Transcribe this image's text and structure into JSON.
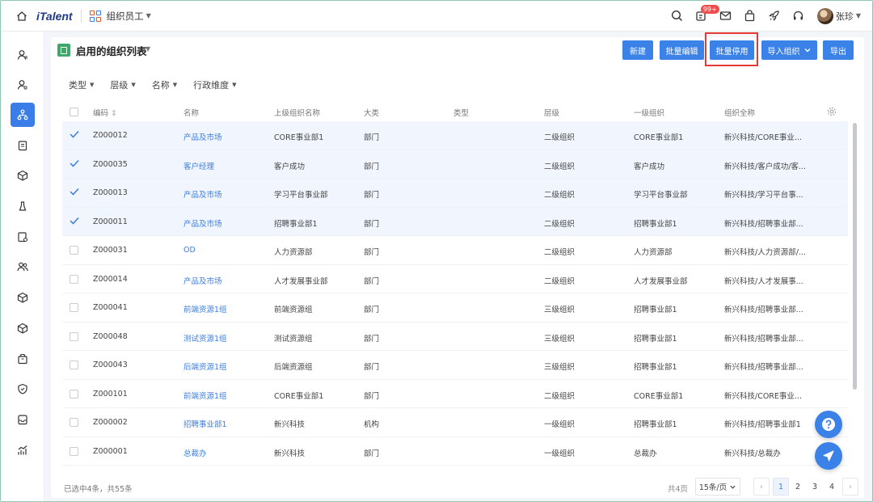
{
  "topbar": {
    "logo": "iTalent",
    "app_name": "组织员工",
    "badge_count": "99+",
    "user_name": "张珍",
    "icons": [
      "home-icon",
      "apps-icon",
      "search-icon",
      "message-icon",
      "mail-icon",
      "bag-icon",
      "rocket-icon",
      "headset-icon"
    ]
  },
  "sidebar": {
    "items": [
      "person-icon",
      "person-search-icon",
      "org-icon",
      "doc-icon",
      "cube-icon",
      "flask-icon",
      "doc-settings-icon",
      "people-icon",
      "cube-icon",
      "cube-icon",
      "box-icon",
      "shield-icon",
      "inbox-icon",
      "chart-icon"
    ],
    "active_index": 2
  },
  "card": {
    "title": "启用的组织列表"
  },
  "toolbar": {
    "new": "新建",
    "batch_edit": "批量编辑",
    "batch_disable": "批量停用",
    "import_org": "导入组织",
    "export": "导出"
  },
  "filters": [
    "类型",
    "层级",
    "名称",
    "行政维度"
  ],
  "table": {
    "headers": [
      "编码",
      "名称",
      "上级组织名称",
      "大类",
      "类型",
      "层级",
      "一级组织",
      "组织全称"
    ],
    "rows": [
      {
        "selected": true,
        "code": "Z000012",
        "name": "产品及市场",
        "parent": "CORE事业部1",
        "category": "部门",
        "type": "",
        "level": "二级组织",
        "first": "CORE事业部1",
        "full": "新兴科技/CORE事业..."
      },
      {
        "selected": true,
        "code": "Z000035",
        "name": "客户经理",
        "parent": "客户成功",
        "category": "部门",
        "type": "",
        "level": "二级组织",
        "first": "客户成功",
        "full": "新兴科技/客户成功/客..."
      },
      {
        "selected": true,
        "code": "Z000013",
        "name": "产品及市场",
        "parent": "学习平台事业部",
        "category": "部门",
        "type": "",
        "level": "二级组织",
        "first": "学习平台事业部",
        "full": "新兴科技/学习平台事..."
      },
      {
        "selected": true,
        "code": "Z000011",
        "name": "产品及市场",
        "parent": "招聘事业部1",
        "category": "部门",
        "type": "",
        "level": "二级组织",
        "first": "招聘事业部1",
        "full": "新兴科技/招聘事业部..."
      },
      {
        "selected": false,
        "code": "Z000031",
        "name": "OD",
        "parent": "人力资源部",
        "category": "部门",
        "type": "",
        "level": "二级组织",
        "first": "人力资源部",
        "full": "新兴科技/人力资源部/..."
      },
      {
        "selected": false,
        "code": "Z000014",
        "name": "产品及市场",
        "parent": "人才发展事业部",
        "category": "部门",
        "type": "",
        "level": "二级组织",
        "first": "人才发展事业部",
        "full": "新兴科技/人才发展事..."
      },
      {
        "selected": false,
        "code": "Z000041",
        "name": "前端资源1组",
        "parent": "前端资源组",
        "category": "部门",
        "type": "",
        "level": "三级组织",
        "first": "招聘事业部1",
        "full": "新兴科技/招聘事业部..."
      },
      {
        "selected": false,
        "code": "Z000048",
        "name": "测试资源1组",
        "parent": "测试资源组",
        "category": "部门",
        "type": "",
        "level": "三级组织",
        "first": "招聘事业部1",
        "full": "新兴科技/招聘事业部..."
      },
      {
        "selected": false,
        "code": "Z000043",
        "name": "后端资源1组",
        "parent": "后端资源组",
        "category": "部门",
        "type": "",
        "level": "三级组织",
        "first": "招聘事业部1",
        "full": "新兴科技/招聘事业部..."
      },
      {
        "selected": false,
        "code": "Z000101",
        "name": "前端资源1组",
        "parent": "CORE事业部1",
        "category": "部门",
        "type": "",
        "level": "二级组织",
        "first": "CORE事业部1",
        "full": "新兴科技/CORE事业..."
      },
      {
        "selected": false,
        "code": "Z000002",
        "name": "招聘事业部1",
        "parent": "新兴科技",
        "category": "机构",
        "type": "",
        "level": "一级组织",
        "first": "招聘事业部1",
        "full": "新兴科技/招聘事业部1"
      },
      {
        "selected": false,
        "code": "Z000001",
        "name": "总裁办",
        "parent": "新兴科技",
        "category": "部门",
        "type": "",
        "level": "一级组织",
        "first": "总裁办",
        "full": "新兴科技/总裁办"
      }
    ]
  },
  "footer": {
    "selection": "已选中4条，共55条",
    "total_pages": "共4页",
    "page_size": "15条/页",
    "pages": [
      "1",
      "2",
      "3",
      "4"
    ],
    "current_page": "1"
  },
  "colors": {
    "primary": "#3b82e8",
    "selected_row": "#f1f6fe",
    "highlight": "#e53935",
    "link": "#3b7de0"
  }
}
